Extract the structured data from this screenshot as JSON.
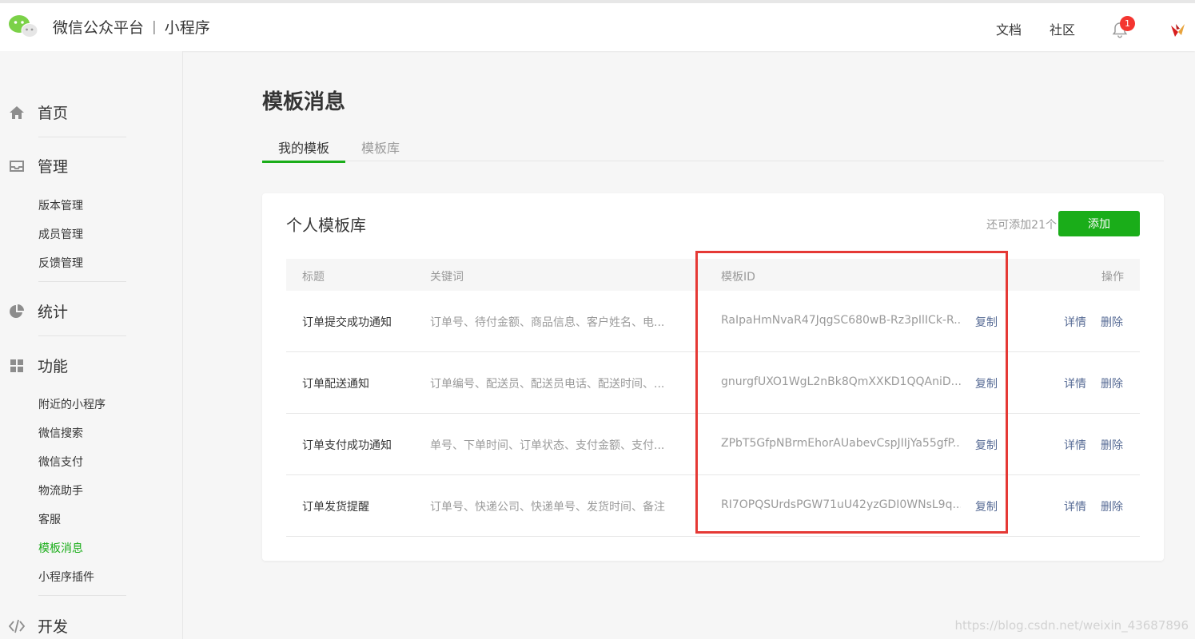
{
  "header": {
    "brand": "微信公众平台",
    "separator": "|",
    "product": "小程序",
    "links": {
      "docs": "文档",
      "community": "社区"
    },
    "notification_count": "1"
  },
  "sidebar": {
    "home": "首页",
    "manage": "管理",
    "manage_items": [
      "版本管理",
      "成员管理",
      "反馈管理"
    ],
    "stats": "统计",
    "features": "功能",
    "feature_items": [
      "附近的小程序",
      "微信搜索",
      "微信支付",
      "物流助手",
      "客服",
      "模板消息",
      "小程序插件"
    ],
    "dev": "开发"
  },
  "main": {
    "title": "模板消息",
    "tabs": [
      "我的模板",
      "模板库"
    ],
    "panel": {
      "title": "个人模板库",
      "remaining": "还可添加21个",
      "add_button": "添加",
      "columns": {
        "title": "标题",
        "keywords": "关键词",
        "template_id": "模板ID",
        "actions": "操作"
      },
      "rows": [
        {
          "title": "订单提交成功通知",
          "keywords": "订单号、待付金额、商品信息、客户姓名、电...",
          "template_id": "RaIpaHmNvaR47JqgSC680wB-Rz3pIlICk-R...",
          "copy": "复制",
          "detail": "详情",
          "delete": "删除"
        },
        {
          "title": "订单配送通知",
          "keywords": "订单编号、配送员、配送员电话、配送时间、...",
          "template_id": "gnurgfUXO1WgL2nBk8QmXXKD1QQAniD...",
          "copy": "复制",
          "detail": "详情",
          "delete": "删除"
        },
        {
          "title": "订单支付成功通知",
          "keywords": "单号、下单时间、订单状态、支付金额、支付...",
          "template_id": "ZPbT5GfpNBrmEhorAUabevCspJIIjYa55gfP...",
          "copy": "复制",
          "detail": "详情",
          "delete": "删除"
        },
        {
          "title": "订单发货提醒",
          "keywords": "订单号、快递公司、快递单号、发货时间、备注",
          "template_id": "RI7OPQSUrdsPGW71uU42yzGDI0WNsL9q...",
          "copy": "复制",
          "detail": "详情",
          "delete": "删除"
        }
      ]
    }
  },
  "watermark": "https://blog.csdn.net/weixin_43687896",
  "colors": {
    "accent": "#1aad19",
    "link": "#576b95",
    "highlight": "#e53935",
    "badge": "#f43530"
  }
}
